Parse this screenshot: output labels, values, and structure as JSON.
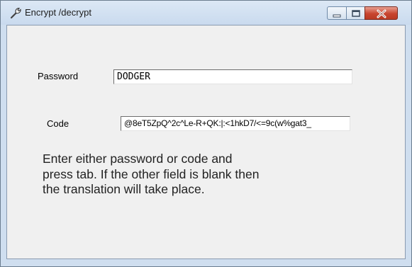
{
  "window": {
    "title": "Encrypt /decrypt",
    "icon": "wrench-icon",
    "controls": [
      "minimize-icon",
      "maximize-icon",
      "close-icon"
    ]
  },
  "form": {
    "password_label": "Password",
    "password_value": "DODGER",
    "code_label": "Code",
    "code_value": "@8eT5ZpQ^2c^Le-R+QK:|:<1hkD7/<=9c(w%gat3_"
  },
  "instructions": {
    "line1": "Enter either password or code and",
    "line2": "press tab. If the other field is blank then",
    "line3": "the translation will take place."
  },
  "colors": {
    "title_bar": "#c9daee",
    "client_bg": "#f0f0f0",
    "close_button": "#c8452f"
  }
}
